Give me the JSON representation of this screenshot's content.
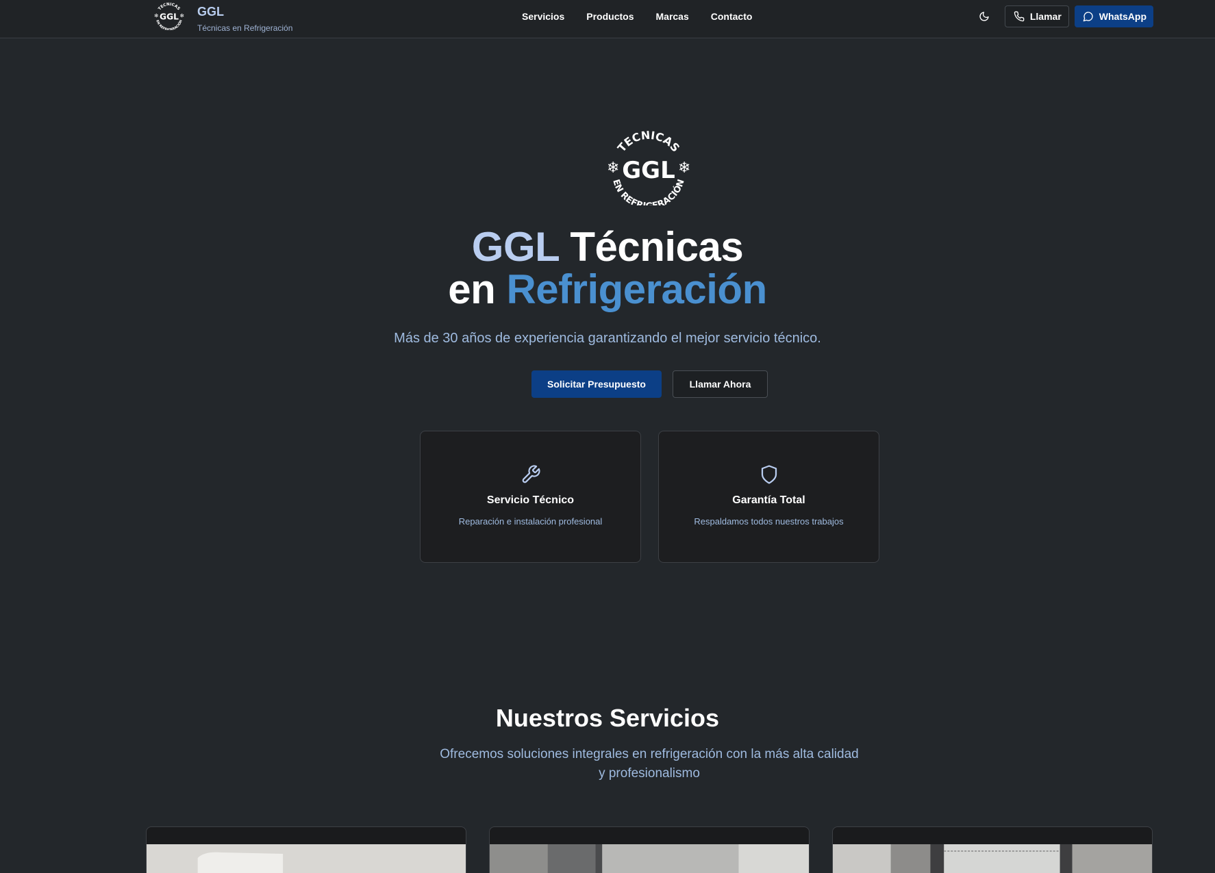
{
  "header": {
    "brand_name": "GGL",
    "brand_subtitle": "Técnicas en Refrigeración",
    "logo_text_top": "TECNICAS",
    "logo_text_bottom": "EN REFRIGERACIÓN",
    "nav": [
      "Servicios",
      "Productos",
      "Marcas",
      "Contacto"
    ],
    "call_label": "Llamar",
    "whatsapp_label": "WhatsApp"
  },
  "hero": {
    "title_part1": "GGL",
    "title_part2": " Técnicas",
    "title_part3": "en ",
    "title_part4": "Refrigeración",
    "subtitle": "Más de 30 años de experiencia garantizando el mejor servicio técnico.",
    "primary_button": "Solicitar Presupuesto",
    "secondary_button": "Llamar Ahora",
    "features": [
      {
        "icon": "wrench-icon",
        "title": "Servicio Técnico",
        "description": "Reparación e instalación profesional"
      },
      {
        "icon": "shield-icon",
        "title": "Garantía Total",
        "description": "Respaldamos todos nuestros trabajos"
      }
    ]
  },
  "services": {
    "title": "Nuestros Servicios",
    "subtitle": "Ofrecemos soluciones integrales en refrigeración con la más alta calidad y profesionalismo"
  },
  "colors": {
    "background": "#23272b",
    "accent_light": "#b9cdf0",
    "accent_blue": "#4a90d0",
    "primary_button": "#0c3f86"
  }
}
